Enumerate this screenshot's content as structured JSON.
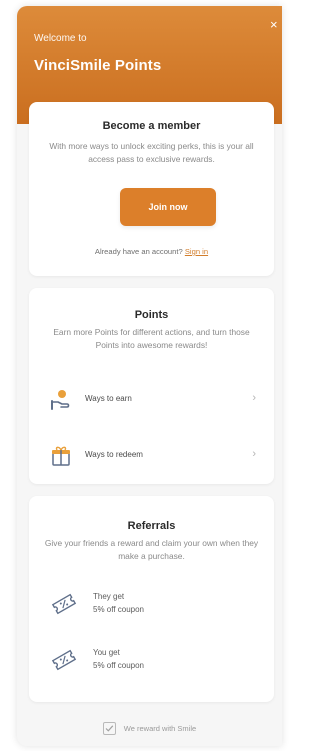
{
  "header": {
    "welcome": "Welcome to",
    "brand": "VinciSmile Points",
    "close_icon": "×"
  },
  "member_card": {
    "title": "Become a member",
    "description": "With more ways to unlock exciting perks, this is your all access pass to exclusive rewards.",
    "join_label": "Join now",
    "account_prompt": "Already have an account?",
    "signin_label": "Sign in"
  },
  "points_card": {
    "title": "Points",
    "description": "Earn more Points for different actions, and turn those Points into awesome rewards!",
    "rows": [
      {
        "label": "Ways to earn",
        "icon": "earn-hand-coin-icon",
        "chevron": "›"
      },
      {
        "label": "Ways to redeem",
        "icon": "gift-box-icon",
        "chevron": "›"
      }
    ]
  },
  "referrals_card": {
    "title": "Referrals",
    "description": "Give your friends a reward and claim your own when they make a purchase.",
    "rows": [
      {
        "line1": "They get",
        "line2": "5% off coupon",
        "icon": "coupon-ticket-icon"
      },
      {
        "line1": "You get",
        "line2": "5% off coupon",
        "icon": "coupon-ticket-icon"
      }
    ]
  },
  "footer": {
    "text": "We reward with Smile",
    "icon": "smile-checkbox-icon"
  },
  "colors": {
    "accent": "#dc7f2a",
    "header_top": "#dd8b3a",
    "header_bottom": "#ca6e1f",
    "link": "#d27d2b"
  }
}
